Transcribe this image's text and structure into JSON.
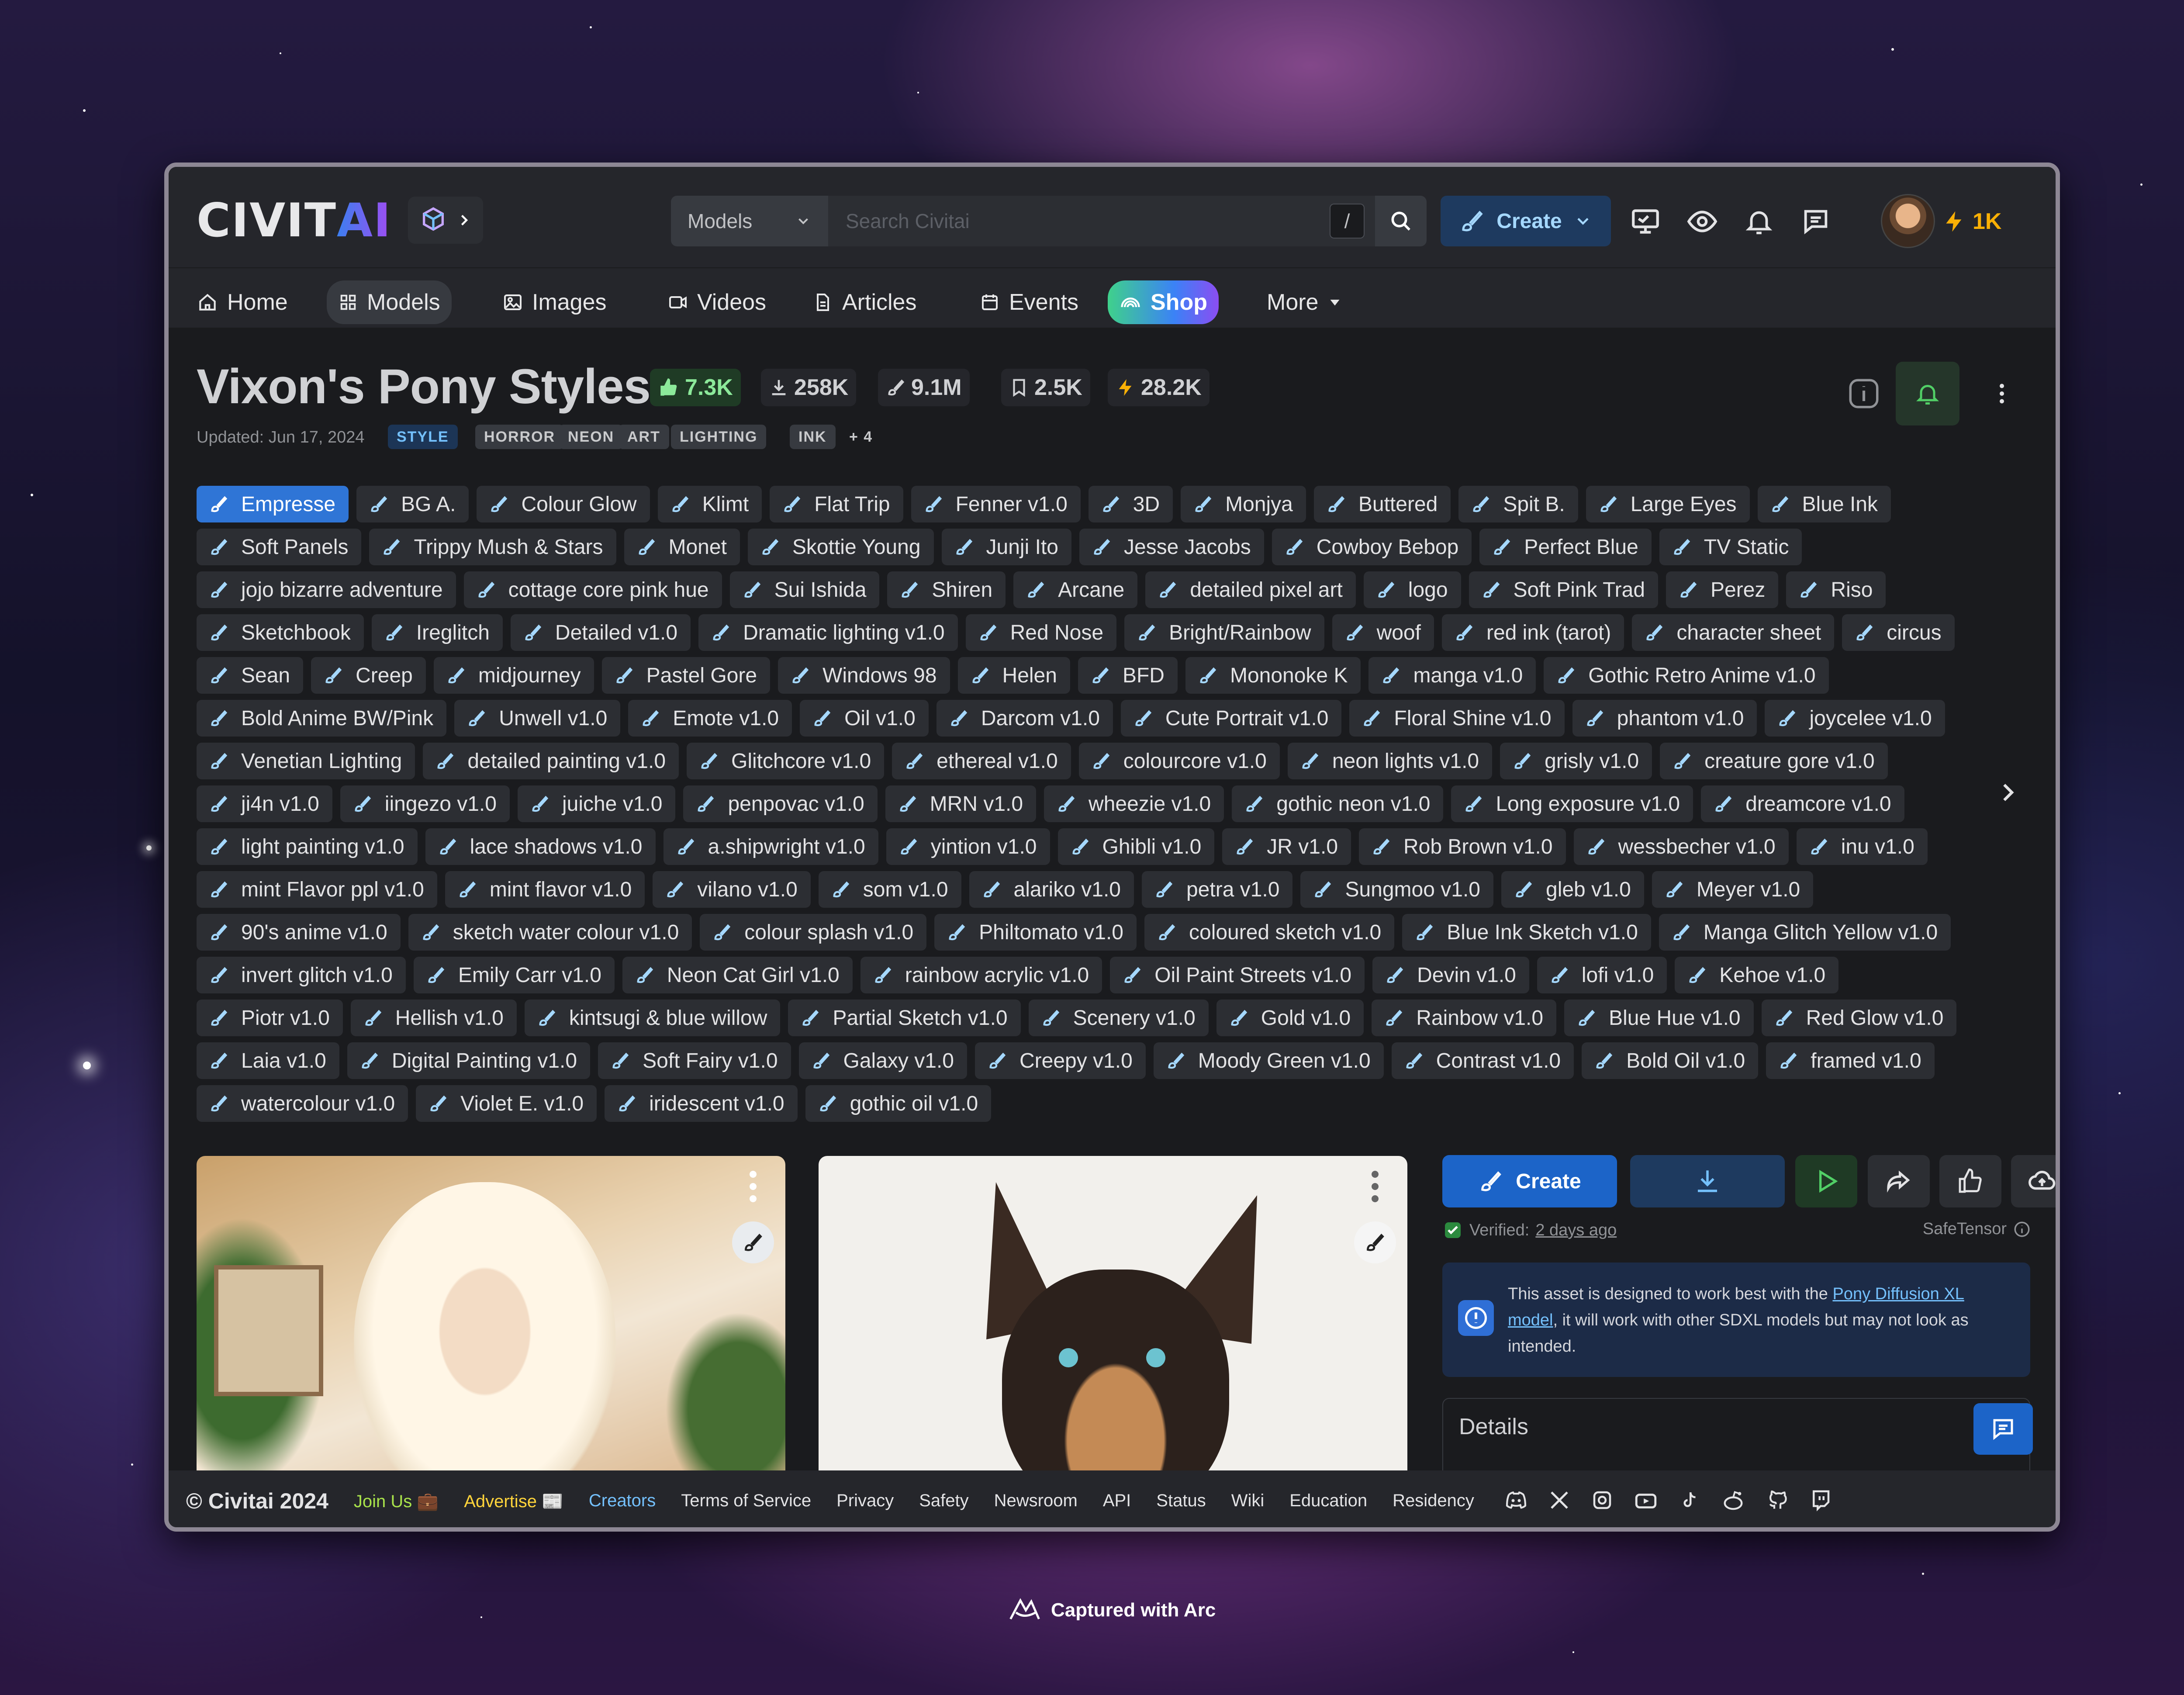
{
  "brand": {
    "logo_main": "CIVIT",
    "logo_ai": "AI"
  },
  "search": {
    "category": "Models",
    "placeholder": "Search Civitai",
    "shortcut": "/"
  },
  "header": {
    "create_label": "Create",
    "buzz": "1K"
  },
  "nav": [
    {
      "label": "Home",
      "icon": "home-icon"
    },
    {
      "label": "Models",
      "icon": "grid-icon"
    },
    {
      "label": "Images",
      "icon": "image-icon"
    },
    {
      "label": "Videos",
      "icon": "video-icon"
    },
    {
      "label": "Articles",
      "icon": "file-icon"
    },
    {
      "label": "Events",
      "icon": "calendar-icon"
    },
    {
      "label": "Shop",
      "icon": "rainbow-icon"
    },
    {
      "label": "More",
      "icon": "caret-down-icon"
    }
  ],
  "model": {
    "title": "Vixon's Pony Styles",
    "stats": {
      "likes": "7.3K",
      "downloads": "258K",
      "generations": "9.1M",
      "bookmarks": "2.5K",
      "buzz": "28.2K"
    },
    "updated": "Updated: Jun 17, 2024",
    "category": "STYLE",
    "tags": [
      "HORROR",
      "NEON",
      "ART",
      "LIGHTING",
      "INK"
    ],
    "more_tags": "+ 4"
  },
  "versions": [
    "Empresse",
    "BG A.",
    "Colour Glow",
    "Klimt",
    "Flat Trip",
    "Fenner v1.0",
    "3D",
    "Monjya",
    "Buttered",
    "Spit B.",
    "Large Eyes",
    "Blue Ink",
    "Soft Panels",
    "Trippy Mush & Stars",
    "Monet",
    "Skottie Young",
    "Junji Ito",
    "Jesse Jacobs",
    "Cowboy Bebop",
    "Perfect Blue",
    "TV Static",
    "jojo bizarre adventure",
    "cottage core pink hue",
    "Sui Ishida",
    "Shiren",
    "Arcane",
    "detailed pixel art",
    "logo",
    "Soft Pink Trad",
    "Perez",
    "Riso",
    "Sketchbook",
    "Ireglitch",
    "Detailed v1.0",
    "Dramatic lighting v1.0",
    "Red Nose",
    "Bright/Rainbow",
    "woof",
    "red ink (tarot)",
    "character sheet",
    "circus",
    "Sean",
    "Creep",
    "midjourney",
    "Pastel Gore",
    "Windows 98",
    "Helen",
    "BFD",
    "Mononoke K",
    "manga v1.0",
    "Gothic Retro Anime v1.0",
    "Bold Anime BW/Pink",
    "Unwell v1.0",
    "Emote v1.0",
    "Oil v1.0",
    "Darcom v1.0",
    "Cute Portrait v1.0",
    "Floral Shine v1.0",
    "phantom v1.0",
    "joycelee v1.0",
    "Venetian Lighting",
    "detailed painting v1.0",
    "Glitchcore v1.0",
    "ethereal v1.0",
    "colourcore v1.0",
    "neon lights v1.0",
    "grisly v1.0",
    "creature gore v1.0",
    "ji4n v1.0",
    "iingezo v1.0",
    "juiche v1.0",
    "penpovac v1.0",
    "MRN v1.0",
    "wheezie v1.0",
    "gothic neon v1.0",
    "Long exposure v1.0",
    "dreamcore v1.0",
    "light painting v1.0",
    "lace shadows v1.0",
    "a.shipwright v1.0",
    "yintion v1.0",
    "Ghibli v1.0",
    "JR v1.0",
    "Rob Brown v1.0",
    "wessbecher v1.0",
    "inu v1.0",
    "mint Flavor ppl v1.0",
    "mint flavor v1.0",
    "vilano v1.0",
    "som v1.0",
    "alariko v1.0",
    "petra v1.0",
    "Sungmoo v1.0",
    "gleb v1.0",
    "Meyer v1.0",
    "90's anime v1.0",
    "sketch water colour v1.0",
    "colour splash v1.0",
    "Philtomato v1.0",
    "coloured sketch v1.0",
    "Blue Ink Sketch v1.0",
    "Manga Glitch Yellow v1.0",
    "invert glitch v1.0",
    "Emily Carr v1.0",
    "Neon Cat Girl v1.0",
    "rainbow acrylic v1.0",
    "Oil Paint Streets v1.0",
    "Devin v1.0",
    "lofi v1.0",
    "Kehoe v1.0",
    "Piotr v1.0",
    "Hellish v1.0",
    "kintsugi & blue willow",
    "Partial Sketch v1.0",
    "Scenery v1.0",
    "Gold v1.0",
    "Rainbow v1.0",
    "Blue Hue v1.0",
    "Red Glow v1.0",
    "Laia v1.0",
    "Digital Painting v1.0",
    "Soft Fairy v1.0",
    "Galaxy v1.0",
    "Creepy v1.0",
    "Moody Green v1.0",
    "Contrast v1.0",
    "Bold Oil v1.0",
    "framed v1.0",
    "watercolour v1.0",
    "Violet E. v1.0",
    "iridescent v1.0",
    "gothic oil v1.0"
  ],
  "sidebar": {
    "create_label": "Create",
    "verified_prefix": "Verified:",
    "verified_when": "2 days ago",
    "format": "SafeTensor",
    "alert_before": "This asset is designed to work best with the ",
    "alert_link": "Pony Diffusion XL model",
    "alert_after": ", it will work with other SDXL models but may not look as intended.",
    "details_label": "Details"
  },
  "footer": {
    "copyright": "© Civitai 2024",
    "links": [
      "Join Us 💼",
      "Advertise 📰",
      "Creators",
      "Terms of Service",
      "Privacy",
      "Safety",
      "Newsroom",
      "API",
      "Status",
      "Wiki",
      "Education",
      "Residency"
    ],
    "link_colors": [
      "#a9e34b",
      "#ffd43b",
      "#74c0fc",
      "#e3e3e5",
      "#e3e3e5",
      "#e3e3e5",
      "#e3e3e5",
      "#e3e3e5",
      "#e3e3e5",
      "#e3e3e5",
      "#e3e3e5",
      "#e3e3e5"
    ]
  },
  "capture": {
    "label": "Captured with Arc"
  }
}
